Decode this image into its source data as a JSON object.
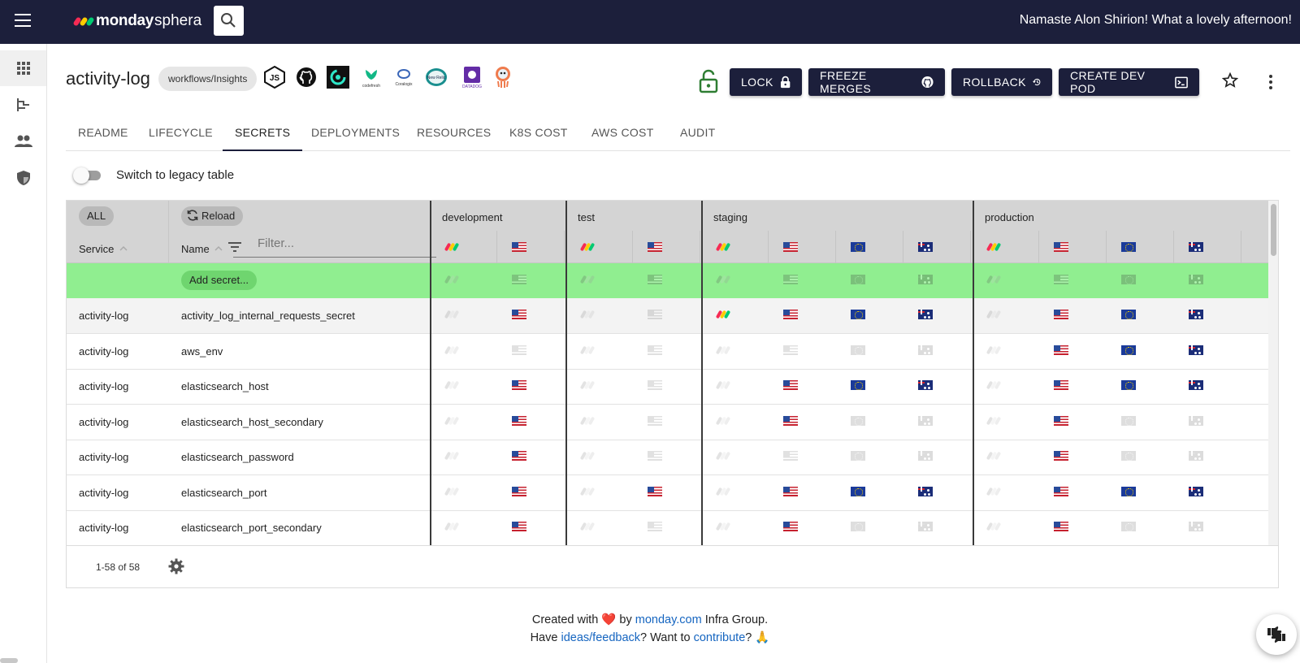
{
  "app": {
    "brand": "monday",
    "brand_suffix": "sphera",
    "greeting": "Namaste Alon Shirion! What a lovely afternoon!"
  },
  "icons": {
    "menu": "hamburger-icon",
    "search": "search-icon",
    "rail": [
      "apps-grid-icon",
      "hierarchy-icon",
      "people-icon",
      "shield-icon"
    ],
    "lock_open": "lock-open-icon",
    "star": "star-outline-icon",
    "more": "more-vert-icon",
    "sort": "arrow-up-icon",
    "filter": "filter-lines-icon",
    "gear": "gear-icon",
    "feedback": "thumbs-icon"
  },
  "colors": {
    "topbar": "#1c1f3b",
    "add_row": "#90ee90",
    "link": "#1565c0",
    "lock_open": "#2e7d32"
  },
  "header": {
    "title": "activity-log",
    "chip": "workflows/Insights",
    "tools": [
      "JS",
      "github",
      "circleci",
      "codefresh",
      "Coralogix",
      "New Relic",
      "DATADOG",
      "argo"
    ]
  },
  "actions": {
    "lock": "LOCK",
    "freeze": "FREEZE MERGES",
    "rollback": "ROLLBACK",
    "devpod": "CREATE DEV POD"
  },
  "tabs": [
    "README",
    "LIFECYCLE",
    "SECRETS",
    "DEPLOYMENTS",
    "RESOURCES",
    "K8S COST",
    "AWS COST",
    "AUDIT"
  ],
  "active_tab": "SECRETS",
  "switch_label": "Switch to legacy table",
  "grid": {
    "all": "ALL",
    "reload": "Reload",
    "col_service": "Service",
    "col_name": "Name",
    "filter_placeholder": "Filter...",
    "add_secret": "Add secret...",
    "environments": [
      "development",
      "test",
      "staging",
      "production"
    ],
    "region_columns": {
      "development": [
        "monday",
        "us"
      ],
      "test": [
        "monday",
        "us"
      ],
      "staging": [
        "monday",
        "us",
        "eu",
        "au"
      ],
      "production": [
        "monday",
        "us",
        "eu",
        "au"
      ]
    },
    "rows": [
      {
        "service": "activity-log",
        "name": "activity_log_internal_requests_secret",
        "cells": [
          0,
          1,
          0,
          0,
          1,
          1,
          1,
          1,
          0,
          1,
          1,
          1
        ]
      },
      {
        "service": "activity-log",
        "name": "aws_env",
        "cells": [
          0,
          0,
          0,
          0,
          0,
          0,
          0,
          0,
          0,
          1,
          1,
          1
        ]
      },
      {
        "service": "activity-log",
        "name": "elasticsearch_host",
        "cells": [
          0,
          1,
          0,
          0,
          0,
          1,
          1,
          1,
          0,
          1,
          1,
          1
        ]
      },
      {
        "service": "activity-log",
        "name": "elasticsearch_host_secondary",
        "cells": [
          0,
          1,
          0,
          0,
          0,
          1,
          0,
          0,
          0,
          1,
          0,
          0
        ]
      },
      {
        "service": "activity-log",
        "name": "elasticsearch_password",
        "cells": [
          0,
          1,
          0,
          0,
          0,
          0,
          0,
          0,
          0,
          1,
          0,
          0
        ]
      },
      {
        "service": "activity-log",
        "name": "elasticsearch_port",
        "cells": [
          0,
          1,
          0,
          1,
          0,
          1,
          1,
          1,
          0,
          1,
          1,
          1
        ]
      },
      {
        "service": "activity-log",
        "name": "elasticsearch_port_secondary",
        "cells": [
          0,
          1,
          0,
          0,
          0,
          1,
          0,
          0,
          0,
          1,
          0,
          0
        ]
      }
    ],
    "pager": "1-58 of 58"
  },
  "footer": {
    "created_prefix": "Created with",
    "heart": "❤️",
    "by": "by",
    "monday_link": "monday.com",
    "created_suffix": "Infra Group.",
    "have": "Have",
    "ideas_link": "ideas/feedback",
    "want": "? Want to",
    "contribute_link": "contribute",
    "end": "? 🙏"
  }
}
